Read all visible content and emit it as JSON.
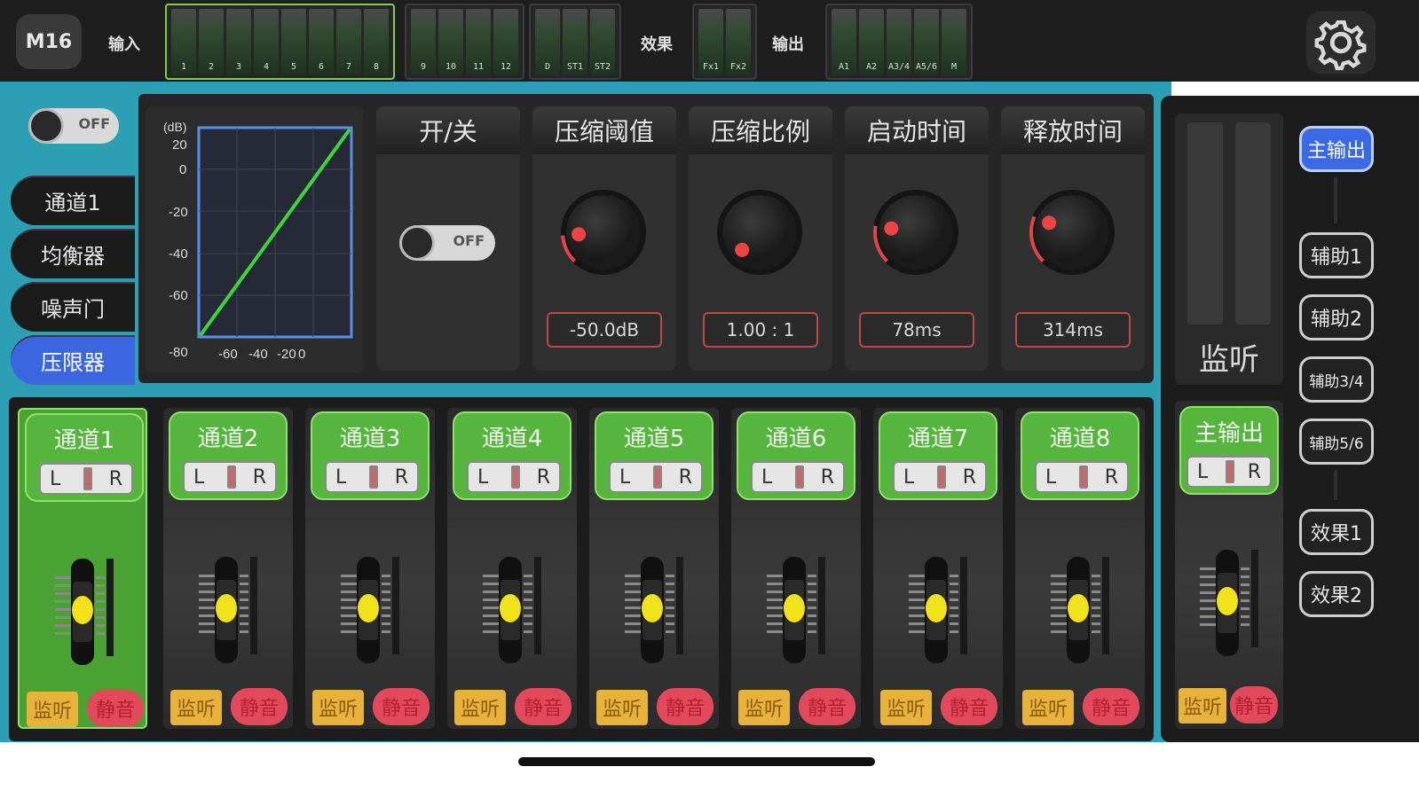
{
  "topbar": {
    "device": "M16",
    "input_label": "输入",
    "fx_label": "效果",
    "output_label": "输出",
    "meter_groups": [
      {
        "meters": [
          "1",
          "2",
          "3",
          "4",
          "5",
          "6",
          "7",
          "8"
        ],
        "selected": true
      },
      {
        "meters": [
          "9",
          "10",
          "11",
          "12"
        ],
        "selected": false
      },
      {
        "meters": [
          "D",
          "ST1",
          "ST2"
        ],
        "selected": false
      },
      {
        "meters": [
          "Fx1",
          "Fx2"
        ],
        "selected": false
      },
      {
        "meters": [
          "A1",
          "A2",
          "A3/4",
          "A5/6",
          "M"
        ],
        "selected": false
      }
    ]
  },
  "nav": {
    "toggle_text": "OFF",
    "items": [
      {
        "label": "通道1",
        "active": false
      },
      {
        "label": "均衡器",
        "active": false
      },
      {
        "label": "噪声门",
        "active": false
      },
      {
        "label": "压限器",
        "active": true
      }
    ]
  },
  "compressor": {
    "graph": {
      "unit": "(dB)",
      "y_ticks": [
        "20",
        "0",
        "-20",
        "-40",
        "-60",
        "-80"
      ],
      "x_ticks": [
        "-60",
        "-40",
        "-20",
        "0"
      ]
    },
    "switch": {
      "title": "开/关",
      "state": "OFF"
    },
    "controls": [
      {
        "title": "压缩阈值",
        "value": "-50.0dB",
        "level": 0.15
      },
      {
        "title": "压缩比例",
        "value": "1.00 : 1",
        "level": 0.0
      },
      {
        "title": "启动时间",
        "value": "78ms",
        "level": 0.2
      },
      {
        "title": "释放时间",
        "value": "314ms",
        "level": 0.25
      }
    ]
  },
  "monitor": {
    "label": "监听"
  },
  "routing": {
    "items": [
      {
        "label": "主输出",
        "active": true
      },
      {
        "label": "辅助1",
        "active": false
      },
      {
        "label": "辅助2",
        "active": false
      },
      {
        "label": "辅助3/4",
        "active": false
      },
      {
        "label": "辅助5/6",
        "active": false
      },
      {
        "label": "效果1",
        "active": false
      },
      {
        "label": "效果2",
        "active": false
      }
    ]
  },
  "strips": {
    "channels": [
      {
        "name": "通道1",
        "selected": true
      },
      {
        "name": "通道2",
        "selected": false
      },
      {
        "name": "通道3",
        "selected": false
      },
      {
        "name": "通道4",
        "selected": false
      },
      {
        "name": "通道5",
        "selected": false
      },
      {
        "name": "通道6",
        "selected": false
      },
      {
        "name": "通道7",
        "selected": false
      },
      {
        "name": "通道8",
        "selected": false
      }
    ],
    "master": {
      "name": "主输出"
    },
    "pan_left": "L",
    "pan_right": "R",
    "monitor_label": "监听",
    "mute_label": "静音"
  },
  "colors": {
    "teal": "#2d9fb5",
    "active_blue": "#3b66e0",
    "strip_green": "#55b53c",
    "monitor_yellow": "#e7b13a",
    "mute_red": "#e24a5c",
    "knob_dot": "#ef4444",
    "fader_cap": "#f2e21a"
  }
}
